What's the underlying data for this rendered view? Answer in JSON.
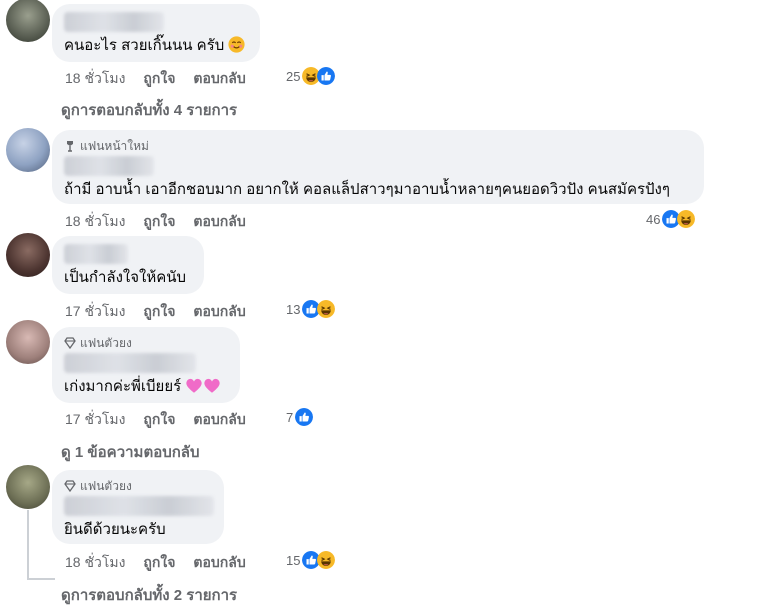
{
  "comments": [
    {
      "badge": "",
      "text": "คนอะไร สวยเกิ๊นนน ครับ",
      "time": "18 ชั่วโมง",
      "like": "ถูกใจ",
      "reply": "ตอบกลับ",
      "count": "25",
      "reactions": [
        "haha-icon",
        "like-icon"
      ]
    },
    {
      "badge": "แฟนหน้าใหม่",
      "text": "ถ้ามี อาบน้ำ เอาอีกชอบมาก อยากให้ คอลแล็ปสาวๆมาอาบน้ำหลายๆคนยอดวิวปัง คนสมัครปังๆ",
      "time": "18 ชั่วโมง",
      "like": "ถูกใจ",
      "reply": "ตอบกลับ",
      "count": "46",
      "reactions": [
        "like-icon",
        "haha-icon"
      ]
    },
    {
      "badge": "",
      "text": "เป็นกำลังใจให้คนับ",
      "time": "17 ชั่วโมง",
      "like": "ถูกใจ",
      "reply": "ตอบกลับ",
      "count": "13",
      "reactions": [
        "like-icon",
        "haha-icon"
      ]
    },
    {
      "badge": "แฟนตัวยง",
      "text": "เก่งมากค่ะพี่เบียยร์",
      "time": "17 ชั่วโมง",
      "like": "ถูกใจ",
      "reply": "ตอบกลับ",
      "count": "7",
      "reactions": [
        "like-icon"
      ]
    },
    {
      "badge": "แฟนตัวยง",
      "text": "ยินดีด้วยนะครับ",
      "time": "18 ชั่วโมง",
      "like": "ถูกใจ",
      "reply": "ตอบกลับ",
      "count": "15",
      "reactions": [
        "like-icon",
        "haha-icon"
      ]
    }
  ],
  "view_replies": [
    "ดูการตอบกลับทั้ง 4 รายการ",
    "ดู 1 ข้อความตอบกลับ",
    "ดูการตอบกลับทั้ง 2 รายการ"
  ],
  "colors": {
    "bubble": "#f0f2f5",
    "meta_text": "#65676b",
    "like_blue": "#1877f2",
    "haha_yellow": "#f7b928"
  }
}
